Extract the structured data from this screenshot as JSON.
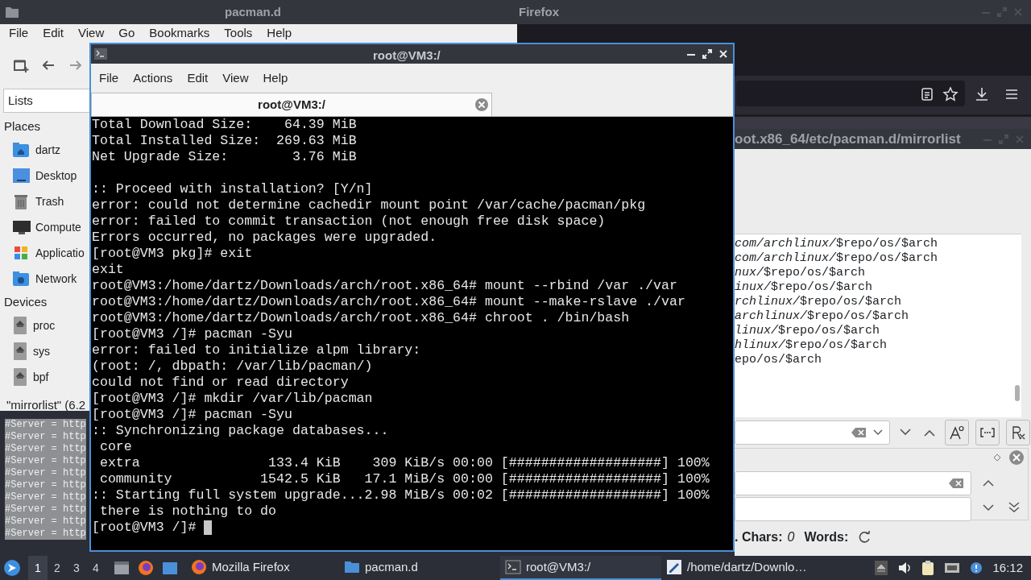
{
  "file_manager": {
    "title": "pacman.d",
    "menu": [
      "File",
      "Edit",
      "View",
      "Go",
      "Bookmarks",
      "Tools",
      "Help"
    ],
    "side_pane_mode": "Lists",
    "places_heading": "Places",
    "places": [
      {
        "label": "dartz",
        "kind": "home"
      },
      {
        "label": "Desktop",
        "kind": "desktop"
      },
      {
        "label": "Trash",
        "kind": "trash"
      },
      {
        "label": "Compute",
        "kind": "computer"
      },
      {
        "label": "Applicatio",
        "kind": "applications"
      },
      {
        "label": "Network",
        "kind": "network"
      }
    ],
    "devices_heading": "Devices",
    "devices": [
      {
        "label": "proc"
      },
      {
        "label": "sys"
      },
      {
        "label": "bpf"
      }
    ],
    "status": "\"mirrorlist\" (6.2"
  },
  "selected_text_lines": [
    "#Server = http",
    "#Server = http",
    "#Server = http",
    "#Server = http",
    "#Server = http",
    "#Server = http",
    "#Server = http",
    "#Server = http",
    "#Server = http",
    "#Server = http"
  ],
  "firefox": {
    "title": "Firefox"
  },
  "text_editor": {
    "title": "oot.x86_64/etc/pacman.d/mirrorlist",
    "lines": [
      {
        "link": "com/archlinux/",
        "text": "$repo/os/$arch"
      },
      {
        "link": "com/archlinux/",
        "text": "$repo/os/$arch"
      },
      {
        "link": "nux/",
        "text": "$repo/os/$arch"
      },
      {
        "link": "inux/",
        "text": "$repo/os/$arch"
      },
      {
        "link": "rchlinux/",
        "text": "$repo/os/$arch"
      },
      {
        "link": "archlinux/",
        "text": "$repo/os/$arch"
      },
      {
        "link": "linux/",
        "text": "$repo/os/$arch"
      },
      {
        "link": "hlinux/",
        "text": "$repo/os/$arch"
      },
      {
        "text": "epo/os/$arch"
      }
    ],
    "chars_label": ". Chars:",
    "chars": "0",
    "words_label": "Words:"
  },
  "terminal": {
    "title": "root@VM3:/",
    "menu": [
      "File",
      "Actions",
      "Edit",
      "View",
      "Help"
    ],
    "tabs": [
      {
        "label": "root@VM3:/",
        "selected": true
      }
    ],
    "blocks": [
      [
        "Total Download Size:    64.39 MiB",
        "Total Installed Size:  269.63 MiB",
        "Net Upgrade Size:        3.76 MiB"
      ],
      [
        ":: Proceed with installation? [Y/n]",
        "error: could not determine cachedir mount point /var/cache/pacman/pkg",
        "error: failed to commit transaction (not enough free disk space)",
        "Errors occurred, no packages were upgraded.",
        "[root@VM3 pkg]# exit",
        "exit",
        "root@VM3:/home/dartz/Downloads/arch/root.x86_64# mount --rbind /var ./var",
        "root@VM3:/home/dartz/Downloads/arch/root.x86_64# mount --make-rslave ./var",
        "root@VM3:/home/dartz/Downloads/arch/root.x86_64# chroot . /bin/bash",
        "[root@VM3 /]# pacman -Syu",
        "error: failed to initialize alpm library:",
        "(root: /, dbpath: /var/lib/pacman/)",
        "could not find or read directory",
        "[root@VM3 /]# mkdir /var/lib/pacman",
        "[root@VM3 /]# pacman -Syu",
        ":: Synchronizing package databases...",
        " core",
        " extra                133.4 KiB    309 KiB/s 00:00 [###################] 100%",
        " community           1542.5 KiB   17.1 MiB/s 00:00 [###################] 100%",
        ":: Starting full system upgrade...2.98 MiB/s 00:02 [###################] 100%",
        " there is nothing to do"
      ]
    ],
    "prompt": "[root@VM3 /]#"
  },
  "taskbar": {
    "workspaces": [
      {
        "label": "1",
        "selected": true
      },
      {
        "label": "2",
        "selected": false
      },
      {
        "label": "3",
        "selected": false
      },
      {
        "label": "4",
        "selected": false
      }
    ],
    "tasks": [
      {
        "label": "Mozilla Firefox",
        "kind": "firefox",
        "selected": false
      },
      {
        "label": "pacman.d",
        "kind": "folder",
        "selected": false
      },
      {
        "label": "root@VM3:/",
        "kind": "terminal",
        "selected": true
      },
      {
        "label": "/home/dartz/Downlo…",
        "kind": "editor",
        "selected": false
      }
    ],
    "clock": "16:12"
  }
}
